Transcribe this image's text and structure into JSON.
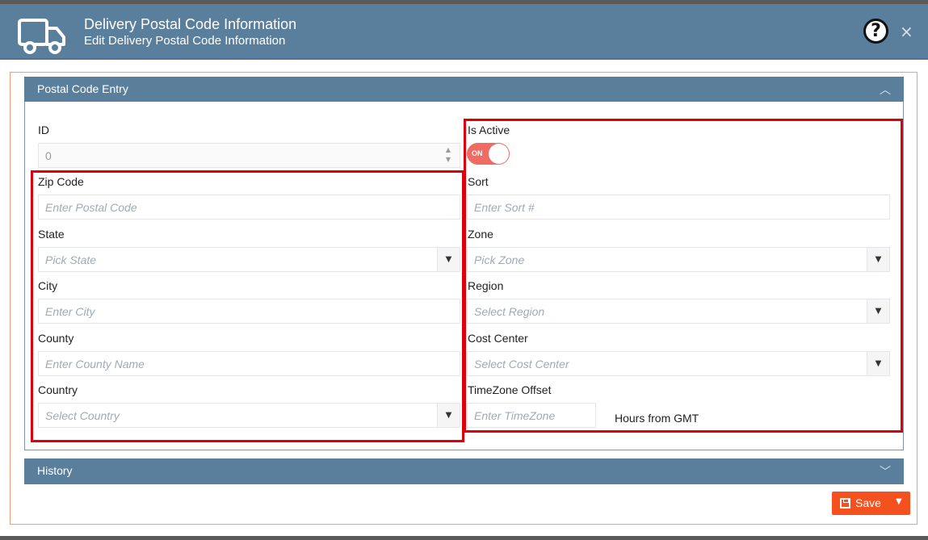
{
  "header": {
    "title": "Delivery Postal Code Information",
    "subtitle": "Edit Delivery Postal Code Information",
    "help_icon": "?",
    "close_icon": "×"
  },
  "panel": {
    "title": "Postal Code Entry",
    "collapse_icon": "chevron-up"
  },
  "left": {
    "id_label": "ID",
    "id_value": "0",
    "zip_label": "Zip Code",
    "zip_placeholder": "Enter Postal Code",
    "state_label": "State",
    "state_placeholder": "Pick State",
    "city_label": "City",
    "city_placeholder": "Enter City",
    "county_label": "County",
    "county_placeholder": "Enter County Name",
    "country_label": "Country",
    "country_placeholder": "Select Country"
  },
  "right": {
    "active_label": "Is Active",
    "toggle_text": "ON",
    "sort_label": "Sort",
    "sort_placeholder": "Enter Sort #",
    "zone_label": "Zone",
    "zone_placeholder": "Pick Zone",
    "region_label": "Region",
    "region_placeholder": "Select Region",
    "cost_label": "Cost Center",
    "cost_placeholder": "Select Cost Center",
    "tz_label": "TimeZone Offset",
    "tz_placeholder": "Enter TimeZone",
    "tz_suffix": "Hours from GMT"
  },
  "history": {
    "title": "History",
    "expand_icon": "chevron-down"
  },
  "actions": {
    "save_label": "Save"
  },
  "colors": {
    "header": "#5a7f9c",
    "accent": "#f4511e",
    "toggle_on": "#f06b64",
    "highlight": "#e0000a"
  }
}
